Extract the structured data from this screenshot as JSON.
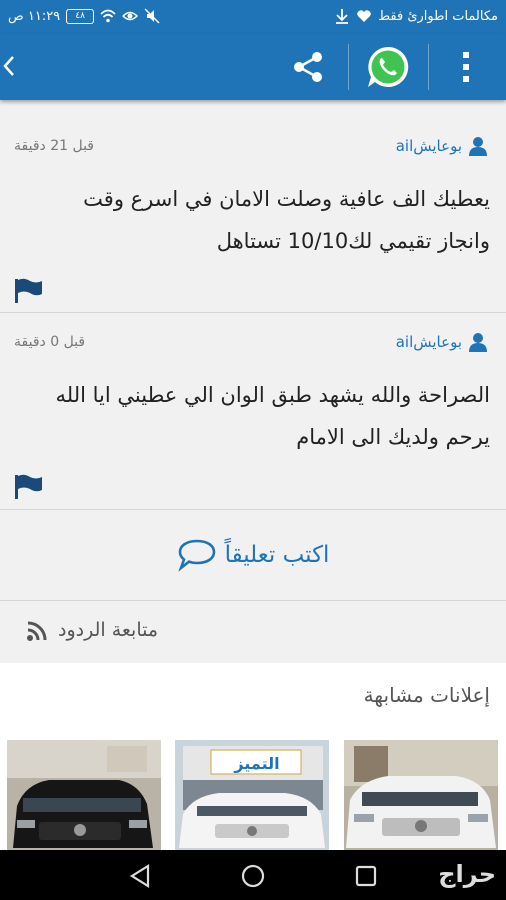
{
  "status_bar": {
    "time": "١١:٢٩ ص",
    "battery": "٤٨",
    "carrier": "مكالمات اطوارئ فقط"
  },
  "app_bar": {
    "icons": [
      "chevron-left-icon",
      "share-icon",
      "whatsapp-icon",
      "more-vertical-icon"
    ]
  },
  "comments": [
    {
      "author": "بوعايشail",
      "time_ago": "قبل 21 دقيقة",
      "lines": [
        "يعطيك الف عافية وصلت الامان في اسرع وقت",
        "وانجاز تقيمي لك10/10 تستاهل"
      ]
    },
    {
      "author": "بوعايشail",
      "time_ago": "قبل 0 دقيقة",
      "lines": [
        "الصراحة والله يشهد طبق الوان الي عطيني ايا الله",
        "يرحم ولديك الى الامام"
      ]
    }
  ],
  "write_comment": {
    "label": "اكتب تعليقاً"
  },
  "follow": {
    "label": "متابعة الردود"
  },
  "similar_ads": {
    "title": "إعلانات مشابهة",
    "thumbnails": [
      {
        "sign_text": "التميز",
        "car_color": "#1a1a1a"
      },
      {
        "sign_text": "",
        "car_color": "#f4f4f4"
      },
      {
        "sign_text": "",
        "car_color": "#f2f2f2"
      }
    ]
  },
  "nav_bar": {
    "brand": "حراج"
  },
  "colors": {
    "primary": "#1f74b8",
    "background": "#f1f1f1"
  }
}
